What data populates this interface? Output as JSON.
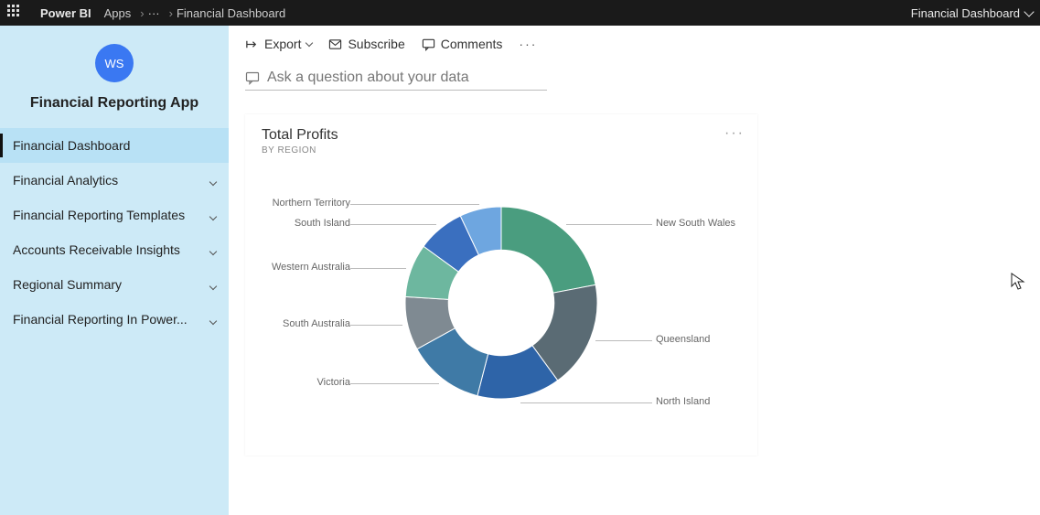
{
  "topbar": {
    "brand": "Power BI",
    "crumbs": [
      "Apps",
      "···",
      "Financial Dashboard"
    ],
    "right_label": "Financial Dashboard"
  },
  "sidebar": {
    "avatar_initials": "WS",
    "app_title": "Financial Reporting App",
    "items": [
      {
        "label": "Financial Dashboard",
        "expandable": false,
        "selected": true
      },
      {
        "label": "Financial Analytics",
        "expandable": true,
        "selected": false
      },
      {
        "label": "Financial Reporting Templates",
        "expandable": true,
        "selected": false
      },
      {
        "label": "Accounts Receivable Insights",
        "expandable": true,
        "selected": false
      },
      {
        "label": "Regional Summary",
        "expandable": true,
        "selected": false
      },
      {
        "label": "Financial Reporting In Power...",
        "expandable": true,
        "selected": false
      }
    ]
  },
  "toolbar": {
    "export": "Export",
    "subscribe": "Subscribe",
    "comments": "Comments"
  },
  "qna": {
    "placeholder": "Ask a question about your data"
  },
  "card": {
    "title": "Total Profits",
    "subtitle": "BY REGION"
  },
  "chart_data": {
    "type": "pie",
    "title": "Total Profits",
    "subtitle": "BY REGION",
    "series": [
      {
        "name": "New South Wales",
        "value": 22,
        "color": "#4a9d7f"
      },
      {
        "name": "Queensland",
        "value": 18,
        "color": "#5a6b74"
      },
      {
        "name": "North Island",
        "value": 14,
        "color": "#2e64a8"
      },
      {
        "name": "Victoria",
        "value": 13,
        "color": "#3f7aa6"
      },
      {
        "name": "South Australia",
        "value": 9,
        "color": "#7f8a92"
      },
      {
        "name": "Western Australia",
        "value": 9,
        "color": "#6db79f"
      },
      {
        "name": "South Island",
        "value": 8,
        "color": "#3a6fbf"
      },
      {
        "name": "Northern Territory",
        "value": 7,
        "color": "#6ea6e0"
      }
    ],
    "inner_radius_ratio": 0.55
  }
}
